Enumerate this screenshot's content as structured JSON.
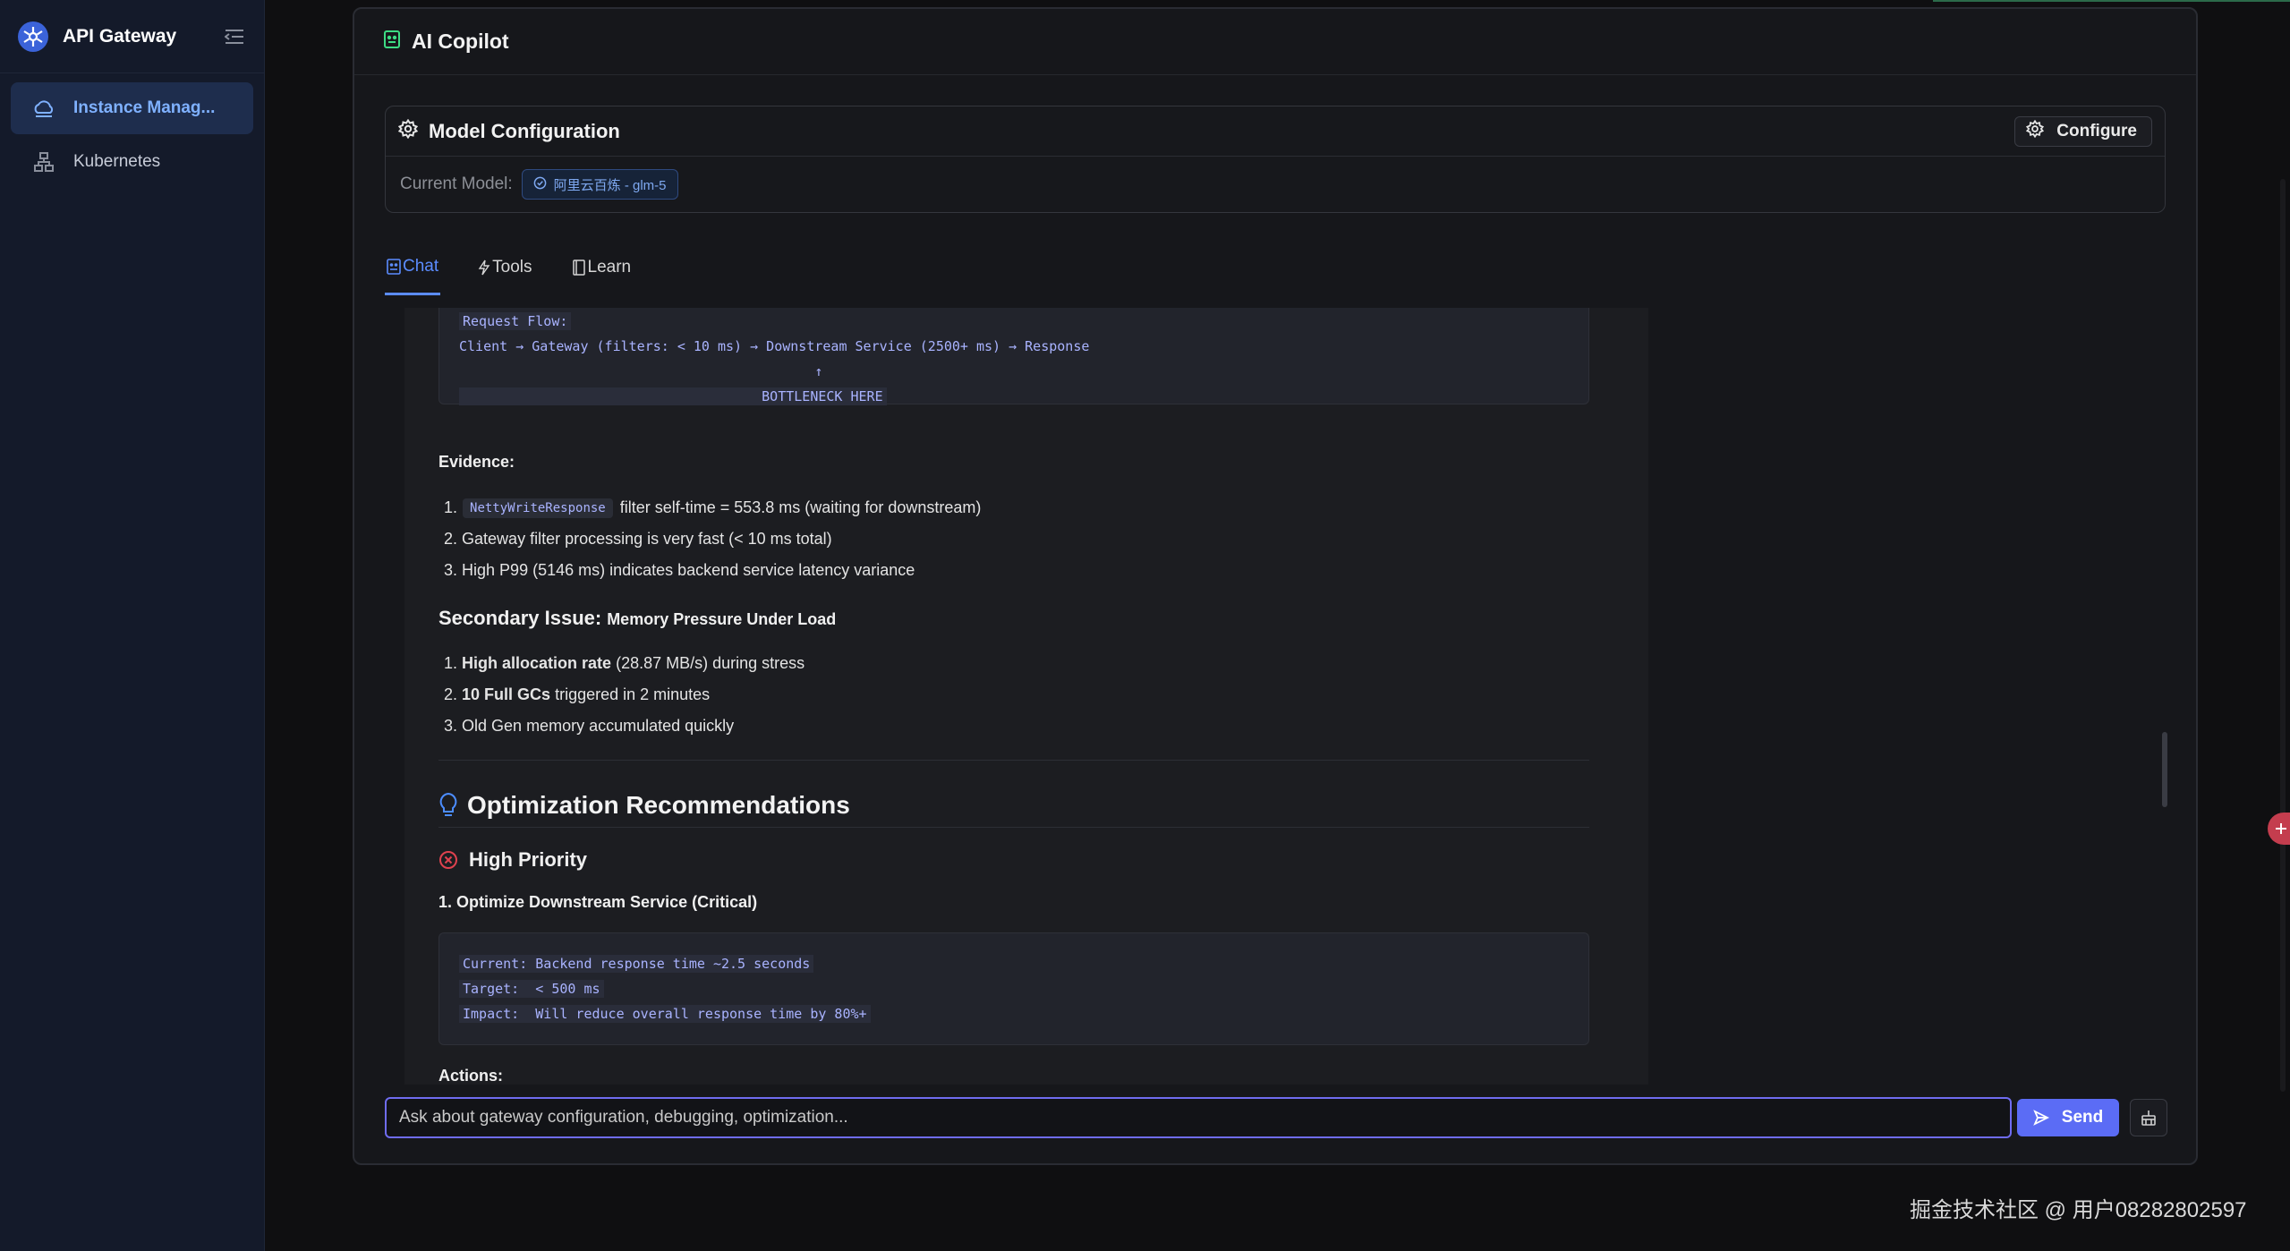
{
  "sidebar": {
    "brand": "API Gateway",
    "items": [
      {
        "label": "Instance Manag...",
        "active": true,
        "icon": "cloud-icon"
      },
      {
        "label": "Kubernetes",
        "active": false,
        "icon": "network-icon"
      }
    ]
  },
  "panel": {
    "title": "AI Copilot",
    "model_config": {
      "title": "Model Configuration",
      "configure_label": "Configure",
      "current_label": "Current Model:",
      "current_value": "阿里云百炼 - glm-5"
    },
    "tabs": [
      {
        "label": "Chat",
        "active": true
      },
      {
        "label": "Tools",
        "active": false
      },
      {
        "label": "Learn",
        "active": false
      }
    ]
  },
  "chat": {
    "flow_code": [
      "Request Flow:",
      "Client → Gateway (filters: < 10 ms) → Downstream Service (2500+ ms) → Response",
      "                                            ↑",
      "                                     BOTTLENECK HERE"
    ],
    "evidence_label": "Evidence:",
    "evidence_items": [
      {
        "prefix": "1.",
        "code": "NettyWriteResponse",
        "text": "filter self-time = 553.8 ms (waiting for downstream)"
      },
      {
        "prefix": "2.",
        "text": "Gateway filter processing is very fast (< 10 ms total)"
      },
      {
        "prefix": "3.",
        "text": "High P99 (5146 ms) indicates backend service latency variance"
      }
    ],
    "secondary_heading": "Secondary Issue:",
    "secondary_sub": "Memory Pressure Under Load",
    "secondary_items": [
      {
        "prefix": "1.",
        "bold": "High allocation rate",
        "text": "(28.87 MB/s) during stress"
      },
      {
        "prefix": "2.",
        "bold": "10 Full GCs",
        "text": "triggered in 2 minutes"
      },
      {
        "prefix": "3.",
        "bold": "",
        "text": "Old Gen memory accumulated quickly"
      }
    ],
    "optimization_heading": "Optimization Recommendations",
    "high_priority_heading": "High Priority",
    "item1_heading": "1. Optimize Downstream Service (Critical)",
    "target_code": [
      "Current: Backend response time ~2.5 seconds",
      "Target:  < 500 ms",
      "Impact:  Will reduce overall response time by 80%+"
    ],
    "actions_label": "Actions:"
  },
  "input": {
    "placeholder": "Ask about gateway configuration, debugging, optimization...",
    "send_label": "Send"
  },
  "watermark": "掘金技术社区 @ 用户08282802597",
  "colors": {
    "accent": "#5b8cff",
    "send": "#5b6cf5",
    "danger": "#e0424f",
    "code_text": "#a9b3ff"
  }
}
